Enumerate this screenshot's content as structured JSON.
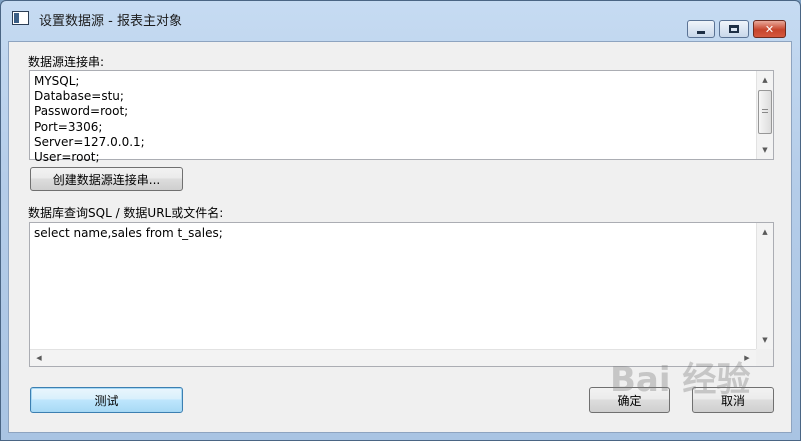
{
  "window": {
    "title": "设置数据源 - 报表主对象"
  },
  "connection": {
    "label": "数据源连接串:",
    "lines": [
      "MYSQL;",
      "Database=stu;",
      "Password=root;",
      "Port=3306;",
      "Server=127.0.0.1;",
      "User=root;"
    ],
    "create_button": "创建数据源连接串..."
  },
  "query": {
    "label": "数据库查询SQL / 数据URL或文件名:",
    "sql": "select name,sales from t_sales;"
  },
  "buttons": {
    "test": "测试",
    "ok": "确定",
    "cancel": "取消"
  },
  "watermark": {
    "text": "Bai 经验"
  }
}
